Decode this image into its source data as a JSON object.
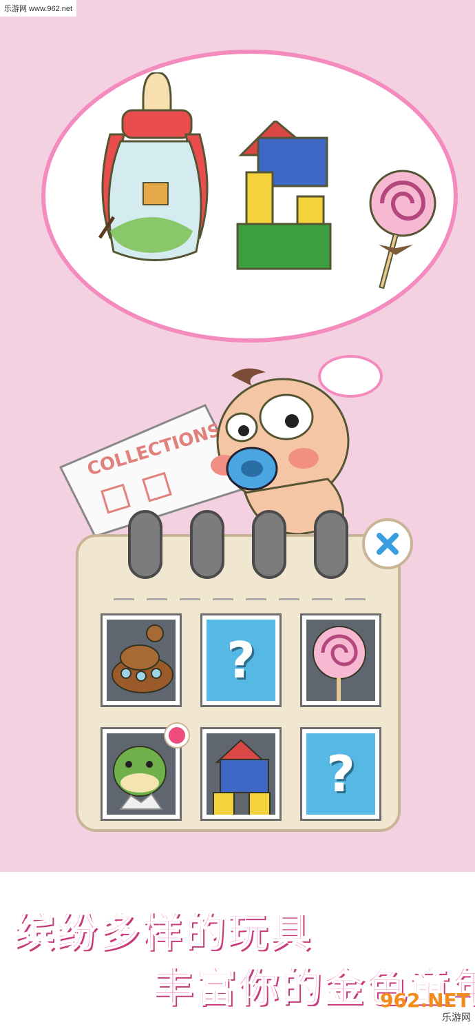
{
  "watermark": {
    "text": "乐游网 www.962.net"
  },
  "collections_sign": {
    "label": "COLLECTIONS"
  },
  "collection": {
    "slots": [
      {
        "state": "unlocked",
        "item": "poop-submarine"
      },
      {
        "state": "locked",
        "symbol": "?"
      },
      {
        "state": "unlocked",
        "item": "lollipop"
      },
      {
        "state": "unlocked",
        "item": "dinosaur",
        "has_new_badge": true
      },
      {
        "state": "unlocked",
        "item": "building-blocks"
      },
      {
        "state": "locked",
        "symbol": "?"
      }
    ]
  },
  "slogan": {
    "line1": "缤纷多样的玩具",
    "line2": "丰富你的金色童年"
  },
  "logo": {
    "top": "962.NET",
    "bottom": "乐游网"
  },
  "colors": {
    "background": "#f3d1e1",
    "bubble_border": "#f48bbf",
    "locked_slot": "#56b8e4",
    "close_icon": "#3a9fe0"
  }
}
